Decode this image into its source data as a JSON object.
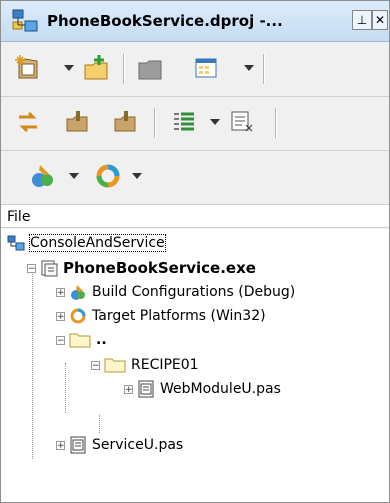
{
  "window": {
    "title": "PhoneBookService.dproj -..."
  },
  "icons": {
    "app": "project-manager-icon",
    "pin": "pin-icon",
    "close": "close-icon"
  },
  "toolbar": {
    "row1": [
      "new-item-icon",
      "add-file-icon",
      "remove-icon",
      "options-icon"
    ],
    "row2": [
      "sync-icon",
      "build-icon",
      "compile-icon",
      "list-icon",
      "sort-icon"
    ],
    "row3": [
      "build-config-icon",
      "target-platform-icon"
    ]
  },
  "panel": {
    "header": "File"
  },
  "tree": {
    "group": "ConsoleAndService",
    "project": "PhoneBookService.exe",
    "build_configurations": "Build Configurations (Debug)",
    "target_platforms": "Target Platforms (Win32)",
    "parent_folder": "..",
    "recipe_folder": "RECIPE01",
    "web_module": "WebModuleU.pas",
    "service_unit": "ServiceU.pas"
  },
  "colors": {
    "title_gradient_top": "#dcecfb",
    "title_gradient_bottom": "#c5dcf3",
    "tool_bg": "#f0f0f0"
  }
}
